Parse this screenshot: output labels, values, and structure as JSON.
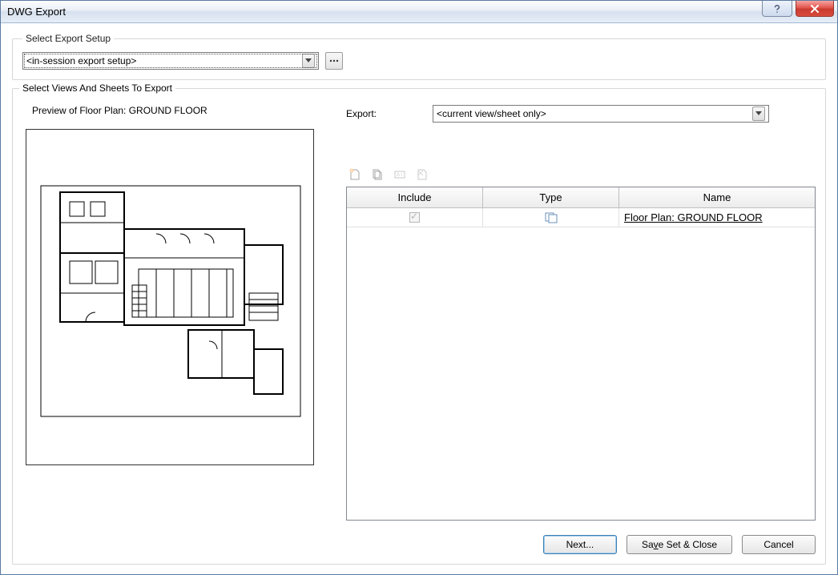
{
  "window": {
    "title": "DWG Export"
  },
  "setup": {
    "legend": "Select Export Setup",
    "dropdown_value": "<in-session export setup>"
  },
  "views": {
    "legend": "Select Views And Sheets To Export",
    "preview_label": "Preview of Floor Plan: GROUND FLOOR",
    "export_label": "Export:",
    "export_dropdown_value": "<current view/sheet only>",
    "columns": {
      "include": "Include",
      "type": "Type",
      "name": "Name"
    },
    "rows": [
      {
        "include_checked": true,
        "name": "Floor Plan: GROUND FLOOR"
      }
    ]
  },
  "buttons": {
    "next": "Next...",
    "save_close_pre": "Sa",
    "save_close_hot": "v",
    "save_close_post": "e Set & Close",
    "cancel": "Cancel"
  }
}
